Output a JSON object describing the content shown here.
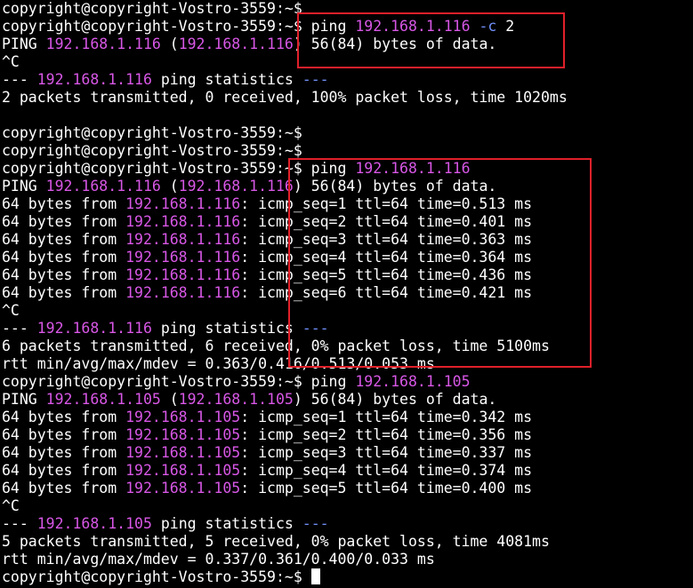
{
  "colors": {
    "background": "#000000",
    "text": "#ffffff",
    "ip": "#d857e6",
    "flag": "#6e8ef6",
    "annotation_box": "#e0202a"
  },
  "terminal": {
    "lines": [
      {
        "segments": [
          {
            "text": "copyright@copyright-Vostro-3559:~$",
            "style": "default"
          }
        ]
      },
      {
        "segments": [
          {
            "text": "copyright@copyright-Vostro-3559:~$ ping ",
            "style": "default"
          },
          {
            "text": "192.168.1.116",
            "style": "magenta"
          },
          {
            "text": " ",
            "style": "default"
          },
          {
            "text": "-c",
            "style": "blue"
          },
          {
            "text": " 2",
            "style": "default"
          }
        ]
      },
      {
        "segments": [
          {
            "text": "PING ",
            "style": "default"
          },
          {
            "text": "192.168.1.116",
            "style": "magenta"
          },
          {
            "text": " (",
            "style": "default"
          },
          {
            "text": "192.168.1.116",
            "style": "magenta"
          },
          {
            "text": ") 56(84) bytes of data.",
            "style": "default"
          }
        ]
      },
      {
        "segments": [
          {
            "text": "^C",
            "style": "default"
          }
        ]
      },
      {
        "segments": [
          {
            "text": "--- ",
            "style": "default"
          },
          {
            "text": "192.168.1.116",
            "style": "magenta"
          },
          {
            "text": " ping statistics ",
            "style": "default"
          },
          {
            "text": "---",
            "style": "blue"
          }
        ]
      },
      {
        "segments": [
          {
            "text": "2 packets transmitted, 0 received, 100% packet loss, time 1020ms",
            "style": "default"
          }
        ]
      },
      {
        "segments": [
          {
            "text": "",
            "style": "default"
          }
        ]
      },
      {
        "segments": [
          {
            "text": "copyright@copyright-Vostro-3559:~$",
            "style": "default"
          }
        ]
      },
      {
        "segments": [
          {
            "text": "copyright@copyright-Vostro-3559:~$",
            "style": "default"
          }
        ]
      },
      {
        "segments": [
          {
            "text": "copyright@copyright-Vostro-3559:~$ ping ",
            "style": "default"
          },
          {
            "text": "192.168.1.116",
            "style": "magenta"
          }
        ]
      },
      {
        "segments": [
          {
            "text": "PING ",
            "style": "default"
          },
          {
            "text": "192.168.1.116",
            "style": "magenta"
          },
          {
            "text": " (",
            "style": "default"
          },
          {
            "text": "192.168.1.116",
            "style": "magenta"
          },
          {
            "text": ") 56(84) bytes of data.",
            "style": "default"
          }
        ]
      },
      {
        "segments": [
          {
            "text": "64 bytes from ",
            "style": "default"
          },
          {
            "text": "192.168.1.116",
            "style": "magenta"
          },
          {
            "text": ": icmp_seq=1 ttl=64 time=0.513 ms",
            "style": "default"
          }
        ]
      },
      {
        "segments": [
          {
            "text": "64 bytes from ",
            "style": "default"
          },
          {
            "text": "192.168.1.116",
            "style": "magenta"
          },
          {
            "text": ": icmp_seq=2 ttl=64 time=0.401 ms",
            "style": "default"
          }
        ]
      },
      {
        "segments": [
          {
            "text": "64 bytes from ",
            "style": "default"
          },
          {
            "text": "192.168.1.116",
            "style": "magenta"
          },
          {
            "text": ": icmp_seq=3 ttl=64 time=0.363 ms",
            "style": "default"
          }
        ]
      },
      {
        "segments": [
          {
            "text": "64 bytes from ",
            "style": "default"
          },
          {
            "text": "192.168.1.116",
            "style": "magenta"
          },
          {
            "text": ": icmp_seq=4 ttl=64 time=0.364 ms",
            "style": "default"
          }
        ]
      },
      {
        "segments": [
          {
            "text": "64 bytes from ",
            "style": "default"
          },
          {
            "text": "192.168.1.116",
            "style": "magenta"
          },
          {
            "text": ": icmp_seq=5 ttl=64 time=0.436 ms",
            "style": "default"
          }
        ]
      },
      {
        "segments": [
          {
            "text": "64 bytes from ",
            "style": "default"
          },
          {
            "text": "192.168.1.116",
            "style": "magenta"
          },
          {
            "text": ": icmp_seq=6 ttl=64 time=0.421 ms",
            "style": "default"
          }
        ]
      },
      {
        "segments": [
          {
            "text": "^C",
            "style": "default"
          }
        ]
      },
      {
        "segments": [
          {
            "text": "--- ",
            "style": "default"
          },
          {
            "text": "192.168.1.116",
            "style": "magenta"
          },
          {
            "text": " ping statistics ",
            "style": "default"
          },
          {
            "text": "---",
            "style": "blue"
          }
        ]
      },
      {
        "segments": [
          {
            "text": "6 packets transmitted, 6 received, 0% packet loss, time 5100ms",
            "style": "default"
          }
        ]
      },
      {
        "segments": [
          {
            "text": "rtt min/avg/max/mdev = 0.363/0.416/0.513/0.053 ms",
            "style": "default"
          }
        ]
      },
      {
        "segments": [
          {
            "text": "copyright@copyright-Vostro-3559:~$ ping ",
            "style": "default"
          },
          {
            "text": "192.168.1.105",
            "style": "magenta"
          }
        ]
      },
      {
        "segments": [
          {
            "text": "PING ",
            "style": "default"
          },
          {
            "text": "192.168.1.105",
            "style": "magenta"
          },
          {
            "text": " (",
            "style": "default"
          },
          {
            "text": "192.168.1.105",
            "style": "magenta"
          },
          {
            "text": ") 56(84) bytes of data.",
            "style": "default"
          }
        ]
      },
      {
        "segments": [
          {
            "text": "64 bytes from ",
            "style": "default"
          },
          {
            "text": "192.168.1.105",
            "style": "magenta"
          },
          {
            "text": ": icmp_seq=1 ttl=64 time=0.342 ms",
            "style": "default"
          }
        ]
      },
      {
        "segments": [
          {
            "text": "64 bytes from ",
            "style": "default"
          },
          {
            "text": "192.168.1.105",
            "style": "magenta"
          },
          {
            "text": ": icmp_seq=2 ttl=64 time=0.356 ms",
            "style": "default"
          }
        ]
      },
      {
        "segments": [
          {
            "text": "64 bytes from ",
            "style": "default"
          },
          {
            "text": "192.168.1.105",
            "style": "magenta"
          },
          {
            "text": ": icmp_seq=3 ttl=64 time=0.337 ms",
            "style": "default"
          }
        ]
      },
      {
        "segments": [
          {
            "text": "64 bytes from ",
            "style": "default"
          },
          {
            "text": "192.168.1.105",
            "style": "magenta"
          },
          {
            "text": ": icmp_seq=4 ttl=64 time=0.374 ms",
            "style": "default"
          }
        ]
      },
      {
        "segments": [
          {
            "text": "64 bytes from ",
            "style": "default"
          },
          {
            "text": "192.168.1.105",
            "style": "magenta"
          },
          {
            "text": ": icmp_seq=5 ttl=64 time=0.400 ms",
            "style": "default"
          }
        ]
      },
      {
        "segments": [
          {
            "text": "^C",
            "style": "default"
          }
        ]
      },
      {
        "segments": [
          {
            "text": "--- ",
            "style": "default"
          },
          {
            "text": "192.168.1.105",
            "style": "magenta"
          },
          {
            "text": " ping statistics ",
            "style": "default"
          },
          {
            "text": "---",
            "style": "blue"
          }
        ]
      },
      {
        "segments": [
          {
            "text": "5 packets transmitted, 5 received, 0% packet loss, time 4081ms",
            "style": "default"
          }
        ]
      },
      {
        "segments": [
          {
            "text": "rtt min/avg/max/mdev = 0.337/0.361/0.400/0.033 ms",
            "style": "default"
          }
        ]
      },
      {
        "segments": [
          {
            "text": "copyright@copyright-Vostro-3559:~$ ",
            "style": "default"
          }
        ],
        "cursor": true
      }
    ]
  }
}
